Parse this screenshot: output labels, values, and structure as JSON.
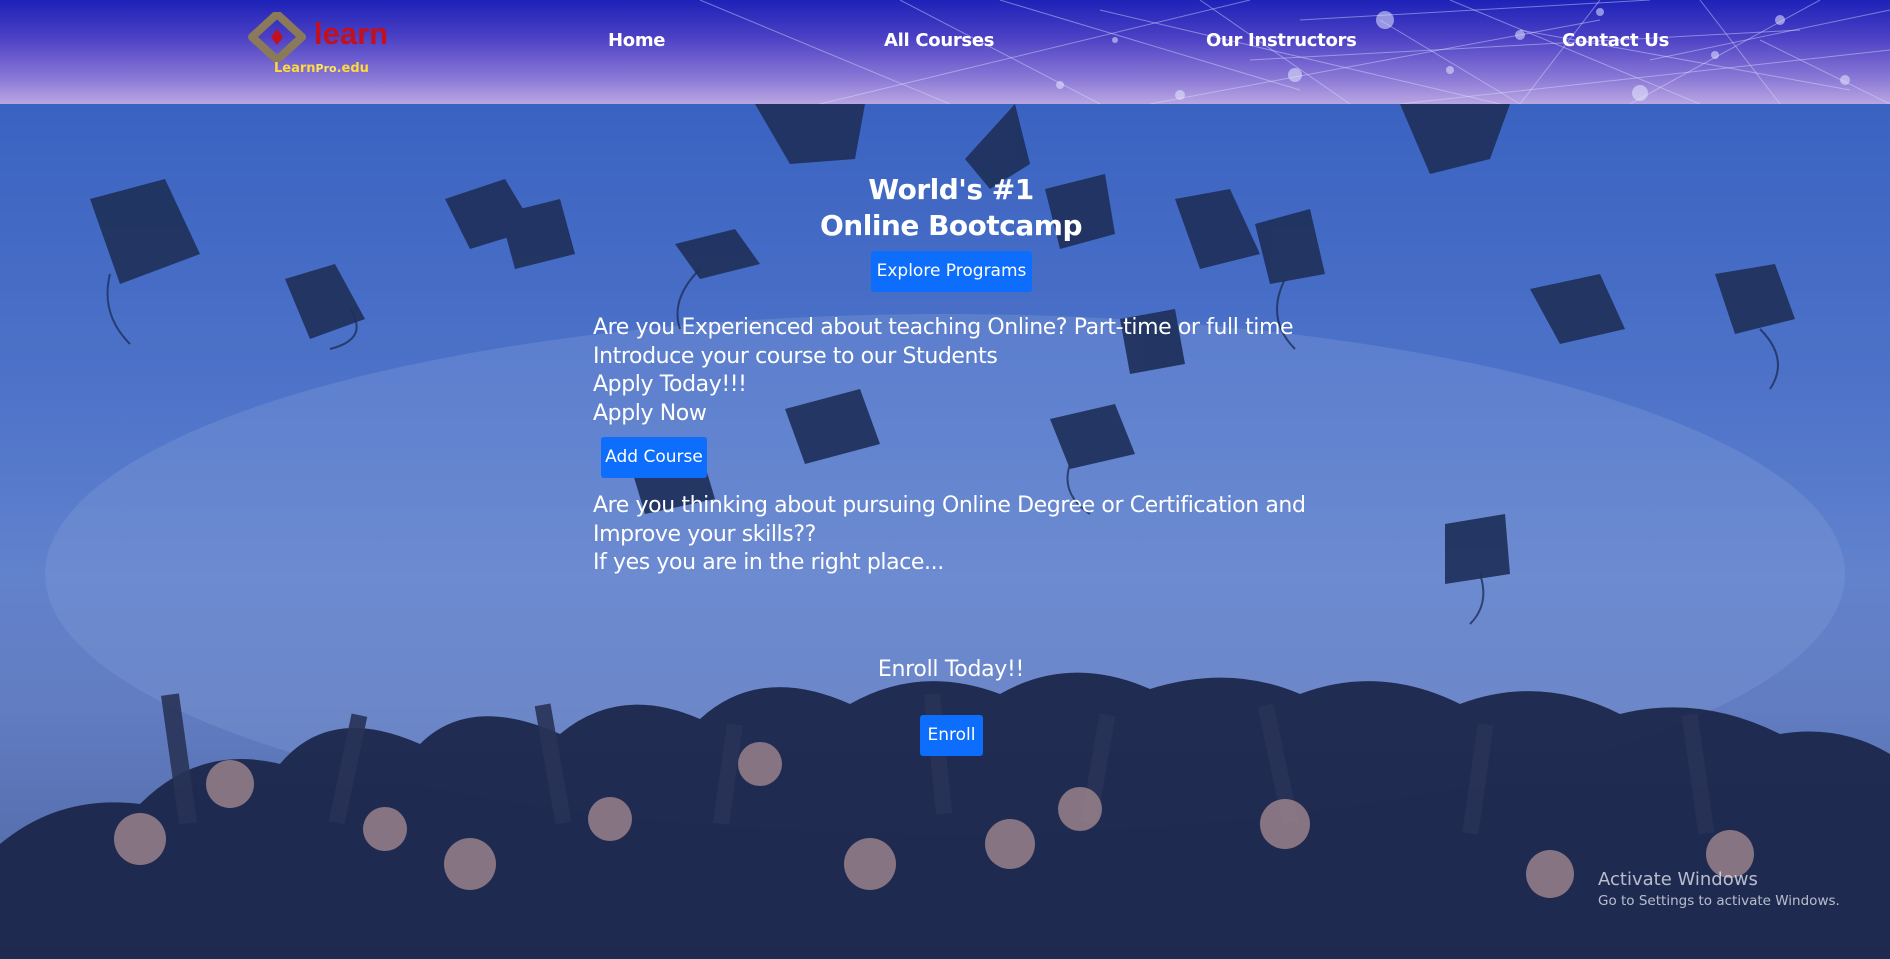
{
  "logo": {
    "word": "learn",
    "sub_a": "Learn",
    "sub_b": "Pro",
    "sub_c": ".edu",
    "mark_colors": [
      "#8a7a5a",
      "#c2101f"
    ]
  },
  "nav": {
    "items": [
      "Home",
      "All Courses",
      "Our Instructors",
      "Contact Us"
    ]
  },
  "hero": {
    "title_line1": "World's #1",
    "title_line2": "Online Bootcamp",
    "explore_label": "Explore Programs",
    "instructor_lines": [
      "Are you Experienced about teaching Online? Part-time or full time",
      "Introduce your course to our Students",
      "Apply Today!!!",
      "Apply Now"
    ],
    "add_course_label": "Add Course",
    "student_lines": [
      "Are you thinking about pursuing Online Degree or Certification and",
      "Improve your skills??",
      "If yes you are in the right place..."
    ],
    "enroll_heading": "Enroll Today!!",
    "enroll_label": "Enroll"
  },
  "watermark": {
    "title": "Activate Windows",
    "subtitle": "Go to Settings to activate Windows."
  },
  "colors": {
    "header_top": "#1d22b8",
    "header_bottom": "#b9a6e2",
    "button": "#0d6efd",
    "logo_red": "#c2101f",
    "logo_yellow": "#ffd93a"
  }
}
